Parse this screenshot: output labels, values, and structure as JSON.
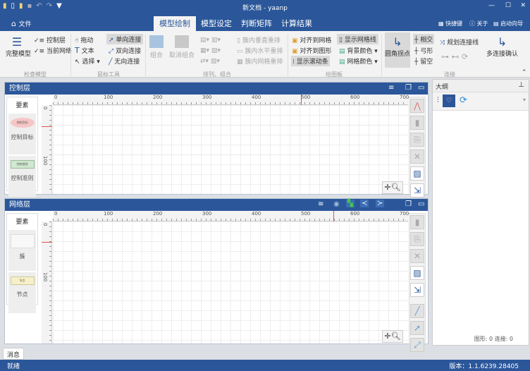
{
  "window": {
    "title": "新文档 - yaanp",
    "minimize": "—",
    "maximize": "☐",
    "close": "✕"
  },
  "quick_access": [
    "▮",
    "▯",
    "▮",
    "▪",
    "↶",
    "↷",
    "▼"
  ],
  "menu": {
    "file": "文件",
    "tabs": [
      "模型绘制",
      "模型设定",
      "判断矩阵",
      "计算结果"
    ],
    "active_tab": "模型绘制",
    "right": {
      "shortcuts": "快捷键",
      "about": "关于",
      "wizard": "启动向导"
    }
  },
  "ribbon": {
    "check_model": {
      "label": "检查模型",
      "complete": "完整模型",
      "control_layer": "控制层",
      "current_network": "当前网络"
    },
    "mouse_tools": {
      "label": "鼠标工具",
      "drag": "拖动",
      "text": "文本",
      "select": "选择",
      "one_way": "单向连接",
      "two_way": "双向连接",
      "no_dir": "无向连接"
    },
    "arrange": {
      "label": "排列、组合",
      "group": "组合",
      "ungroup": "取消组合",
      "cluster_vertical": "簇内垂直重排",
      "cluster_horizontal": "簇内水平重排",
      "cluster_grid": "簇内网格重排"
    },
    "canvas": {
      "label": "绘图板",
      "align_grid": "对齐到网格",
      "align_shape": "对齐到图形",
      "show_scroll": "显示滚动条",
      "show_gridlines": "显示网格线",
      "bg_color": "背景颜色",
      "grid_color": "网格颜色"
    },
    "connect": {
      "label": "连接",
      "round_corner": "圆角拐点",
      "intersect": "相交",
      "arc": "弓形",
      "gap": "留空",
      "plan_lines": "规划连接线",
      "multi_confirm": "多连接确认"
    }
  },
  "control_panel": {
    "title": "控制层",
    "palette_title": "要素",
    "items": [
      {
        "label": "控制目标",
        "shape": "控制目标"
      },
      {
        "label": "控制准则",
        "shape": "控制准则"
      }
    ]
  },
  "network_panel": {
    "title": "网络层",
    "palette_title": "要素",
    "items": [
      {
        "label": "簇"
      },
      {
        "label": "节点",
        "shape": "节点"
      }
    ]
  },
  "ruler": {
    "h": [
      "0",
      "100",
      "200",
      "300",
      "400",
      "500",
      "600",
      "700"
    ],
    "v": [
      "0",
      "100"
    ]
  },
  "outline": {
    "title": "大纲",
    "pin": "⊥",
    "stats": "图形: 0   连接: 0"
  },
  "message_tab": "消息",
  "status": {
    "left": "就绪",
    "version": "版本：1.1.6239.28405"
  },
  "colors": {
    "brand": "#2b579a",
    "ruler_marker": "#e05050"
  }
}
